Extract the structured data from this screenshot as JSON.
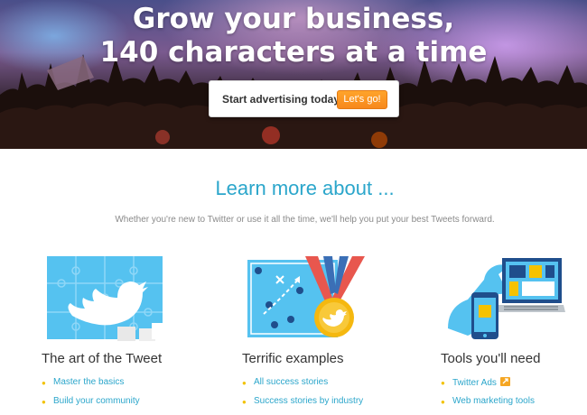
{
  "hero": {
    "title_line1": "Grow your business,",
    "title_line2": "140 characters at a time",
    "cta_text": "Start advertising today",
    "cta_button": "Let's go!"
  },
  "learn": {
    "title": "Learn more about ...",
    "subtitle": "Whether you're new to Twitter or use it all the time, we'll help you put your best Tweets forward."
  },
  "columns": [
    {
      "icon": "puzzle-twitter-bird-icon",
      "title": "The art of the Tweet",
      "links": [
        "Master the basics",
        "Build your community"
      ]
    },
    {
      "icon": "playbook-medal-icon",
      "title": "Terrific examples",
      "links": [
        "All success stories",
        "Success stories by industry"
      ]
    },
    {
      "icon": "devices-wrench-icon",
      "title": "Tools you'll need",
      "links": [
        "Twitter Ads",
        "Web marketing tools"
      ]
    }
  ],
  "colors": {
    "accent": "#2ba6cb",
    "cta": "#f7881c",
    "bullet": "#f2c200"
  }
}
